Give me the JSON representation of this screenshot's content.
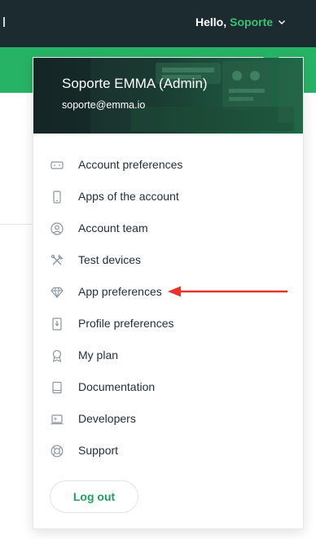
{
  "header": {
    "greeting": "Hello,",
    "username": "Soporte"
  },
  "account": {
    "name": "Soporte EMMA (Admin)",
    "email": "soporte@emma.io"
  },
  "menu": {
    "items": [
      {
        "label": "Account preferences",
        "icon": "keyboard-icon"
      },
      {
        "label": "Apps of the account",
        "icon": "smartphone-icon"
      },
      {
        "label": "Account team",
        "icon": "user-circle-icon"
      },
      {
        "label": "Test devices",
        "icon": "tools-icon"
      },
      {
        "label": "App preferences",
        "icon": "diamond-icon"
      },
      {
        "label": "Profile preferences",
        "icon": "profile-card-icon"
      },
      {
        "label": "My plan",
        "icon": "award-icon"
      },
      {
        "label": "Documentation",
        "icon": "book-icon"
      },
      {
        "label": "Developers",
        "icon": "terminal-icon"
      },
      {
        "label": "Support",
        "icon": "lifebuoy-icon"
      }
    ],
    "logout_label": "Log out"
  },
  "colors": {
    "topbar": "#1b2b30",
    "accent": "#27b366",
    "annotation": "#e8322a"
  }
}
